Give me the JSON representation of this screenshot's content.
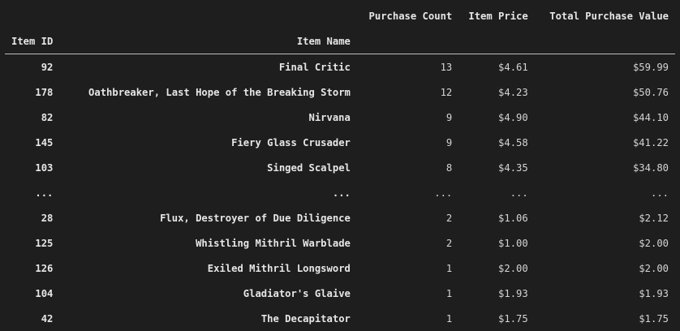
{
  "table": {
    "columns": {
      "purchase_count": "Purchase Count",
      "item_price": "Item Price",
      "total_purchase_value": "Total Purchase Value"
    },
    "index_names": {
      "item_id": "Item ID",
      "item_name": "Item Name"
    },
    "rows": [
      {
        "id": "92",
        "name": "Final Critic",
        "count": "13",
        "price": "$4.61",
        "total": "$59.99"
      },
      {
        "id": "178",
        "name": "Oathbreaker, Last Hope of the Breaking Storm",
        "count": "12",
        "price": "$4.23",
        "total": "$50.76"
      },
      {
        "id": "82",
        "name": "Nirvana",
        "count": "9",
        "price": "$4.90",
        "total": "$44.10"
      },
      {
        "id": "145",
        "name": "Fiery Glass Crusader",
        "count": "9",
        "price": "$4.58",
        "total": "$41.22"
      },
      {
        "id": "103",
        "name": "Singed Scalpel",
        "count": "8",
        "price": "$4.35",
        "total": "$34.80"
      },
      {
        "id": "...",
        "name": "...",
        "count": "...",
        "price": "...",
        "total": "..."
      },
      {
        "id": "28",
        "name": "Flux, Destroyer of Due Diligence",
        "count": "2",
        "price": "$1.06",
        "total": "$2.12"
      },
      {
        "id": "125",
        "name": "Whistling Mithril Warblade",
        "count": "2",
        "price": "$1.00",
        "total": "$2.00"
      },
      {
        "id": "126",
        "name": "Exiled Mithril Longsword",
        "count": "1",
        "price": "$2.00",
        "total": "$2.00"
      },
      {
        "id": "104",
        "name": "Gladiator's Glaive",
        "count": "1",
        "price": "$1.93",
        "total": "$1.93"
      },
      {
        "id": "42",
        "name": "The Decapitator",
        "count": "1",
        "price": "$1.75",
        "total": "$1.75"
      }
    ]
  }
}
